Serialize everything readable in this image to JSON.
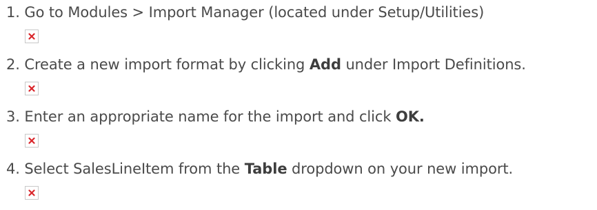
{
  "steps": [
    {
      "number": "1.",
      "text_before": "Go to Modules > Import Manager (located under Setup/Utilities)",
      "bold": "",
      "text_after": "",
      "image_icon": "broken-image-icon"
    },
    {
      "number": "2.",
      "text_before": "Create a new import format by clicking ",
      "bold": "Add",
      "text_after": " under Import Definitions.",
      "image_icon": "broken-image-icon"
    },
    {
      "number": "3.",
      "text_before": "Enter an appropriate name for the import and click ",
      "bold": "OK.",
      "text_after": "",
      "image_icon": "broken-image-icon"
    },
    {
      "number": "4.",
      "text_before": "Select SalesLineItem from the ",
      "bold": "Table",
      "text_after": " dropdown on your new import.",
      "image_icon": "broken-image-icon"
    }
  ],
  "colors": {
    "text": "#4a4a4a",
    "broken_icon_x": "#d9262b",
    "broken_icon_border": "#c8c8c8"
  }
}
